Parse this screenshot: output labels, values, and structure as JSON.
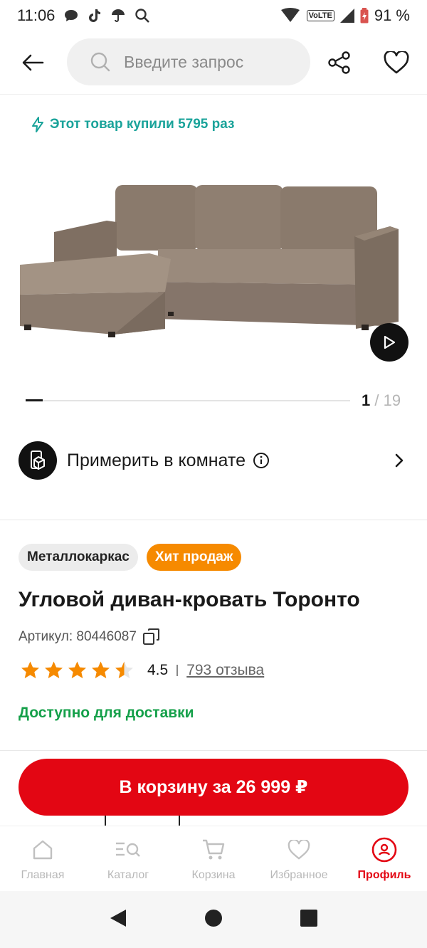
{
  "status_bar": {
    "time": "11:06",
    "battery": "91 %",
    "network": "VoLTE"
  },
  "search": {
    "placeholder": "Введите запрос"
  },
  "purchased_banner": "Этот товар купили 5795 раз",
  "gallery": {
    "current": "1",
    "separator": " / ",
    "total": "19"
  },
  "try_in_room": {
    "label": "Примерить в комнате"
  },
  "tags": [
    "Металлокаркас",
    "Хит продаж"
  ],
  "product": {
    "title": "Угловой диван-кровать Торонто",
    "article": "Артикул: 80446087",
    "rating": "4.5",
    "rating_value": 4.5,
    "reviews": "793 отзыва",
    "availability": "Доступно для доставки"
  },
  "cart_button": {
    "label": "В корзину за 26 999 ₽"
  },
  "bottom_nav": [
    {
      "label": "Главная",
      "icon": "home-icon"
    },
    {
      "label": "Каталог",
      "icon": "catalog-icon"
    },
    {
      "label": "Корзина",
      "icon": "cart-icon"
    },
    {
      "label": "Избранное",
      "icon": "heart-icon"
    },
    {
      "label": "Профиль",
      "icon": "profile-icon",
      "active": true
    }
  ],
  "colors": {
    "accent": "#e30613",
    "teal": "#1aa39a",
    "green": "#15a04a",
    "orange": "#f68a00",
    "star": "#f68a00"
  }
}
